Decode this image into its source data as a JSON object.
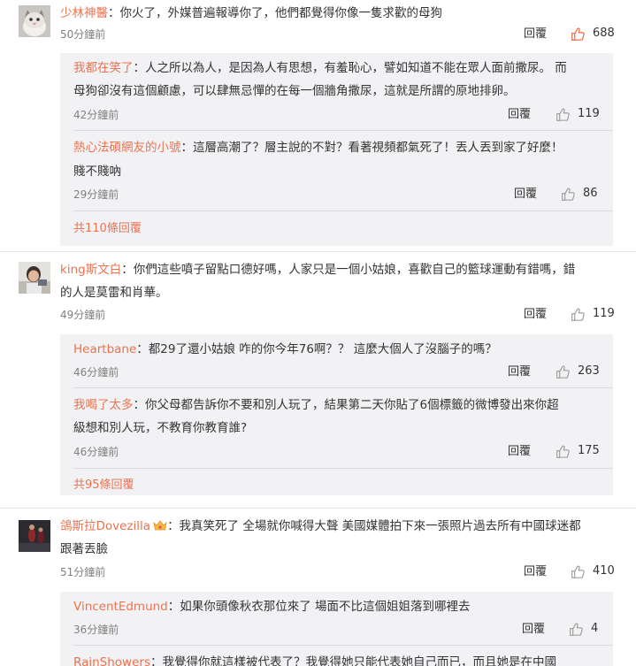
{
  "comments": [
    {
      "user": "少林神醫",
      "text": "：你火了，外媒普遍報導你了，他們都覺得你像一隻求歡的母狗",
      "time": "50分鐘前",
      "reply": "回覆",
      "likes": "688",
      "liked": true,
      "replies": [
        {
          "user": "我都在笑了",
          "line1": "：人之所以為人，是因為人有思想，有羞恥心，譬如知道不能在眾人面前撒尿。 而",
          "line2": "母狗卻沒有這個顧慮，可以肆無忌憚的在每一個牆角撒尿，這就是所謂的原地排卵。",
          "time": "42分鐘前",
          "reply": "回覆",
          "likes": "119"
        },
        {
          "user": "熱心法碩網友的小號",
          "line1": "：這層高潮了？層主說的不對？看著視頻都氣死了！丟人丟到家了好麼！",
          "line2": "賤不賤吶",
          "time": "29分鐘前",
          "reply": "回覆",
          "likes": "86"
        }
      ],
      "more": "共110條回覆"
    },
    {
      "user": "king斯文白",
      "text1": "：你們這些噴子留點口德好嗎，人家只是一個小姑娘，喜歡自己的籃球運動有錯嗎，錯",
      "text2": "的人是莫雷和肖華。",
      "time": "49分鐘前",
      "reply": "回覆",
      "likes": "119",
      "replies": [
        {
          "user": "Heartbane",
          "line1": "：都29了還小姑娘 咋的你今年76啊？？ 這麼大個人了沒腦子的嗎？",
          "time": "46分鐘前",
          "reply": "回覆",
          "likes": "263"
        },
        {
          "user": "我喝了太多",
          "line1": "：你父母都告訴你不要和別人玩了，結果第二天你貼了6個標籤的微博發出來你超",
          "line2": "級想和別人玩，不教育你教育誰?",
          "time": "46分鐘前",
          "reply": "回覆",
          "likes": "175"
        }
      ],
      "more": "共95條回覆"
    },
    {
      "user": "鴿斯拉Dovezilla",
      "text1": "：我真笑死了 全場就你喊得大聲 美國媒體拍下來一張照片過去所有中國球迷都",
      "text2": "跟著丟臉",
      "time": "51分鐘前",
      "reply": "回覆",
      "likes": "410",
      "replies": [
        {
          "user": "VincentEdmund",
          "line1": "：如果你頭像秋衣那位來了 場面不比這個姐姐落到哪裡去",
          "time": "36分鐘前",
          "reply": "回覆",
          "likes": "4"
        },
        {
          "user": "RainShowers",
          "line1": "：我覺得你就這樣被代表了？我覺得她只能代表她自己而已，而且她是在中國"
        }
      ]
    }
  ],
  "colors": {
    "accent": "#eb7350",
    "box": "#f2f2f5",
    "muted": "#808080"
  }
}
